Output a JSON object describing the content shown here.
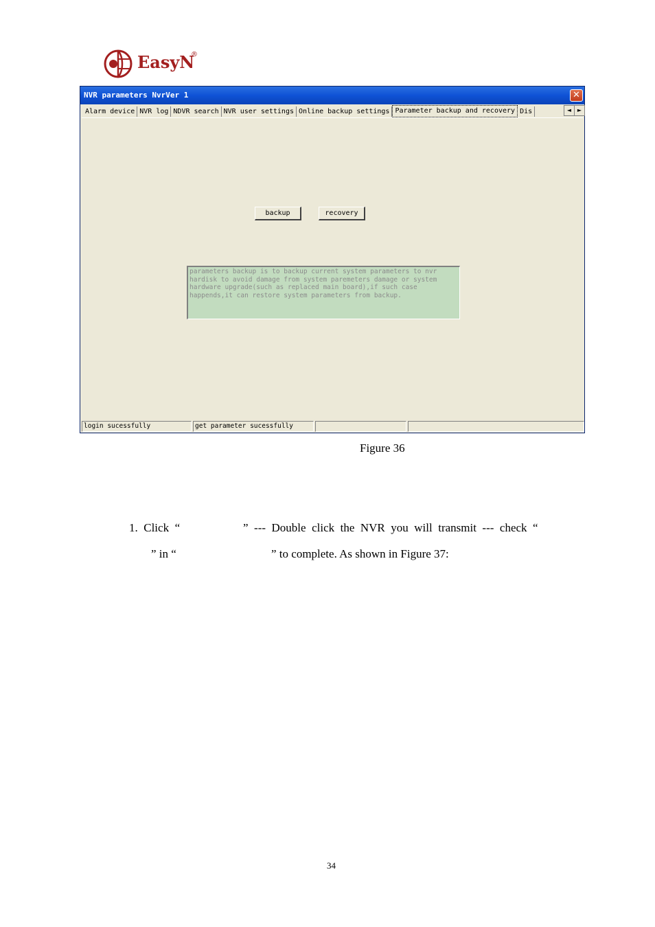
{
  "logo": {
    "text": "EasyN",
    "registered": "®",
    "color": "#a31f1f"
  },
  "window": {
    "title": "NVR parameters NvrVer 1",
    "close": "✕",
    "tabs": [
      "Alarm device",
      "NVR log",
      "NDVR search",
      "NVR user settings",
      "Online backup settings",
      "Parameter backup and recovery",
      "Dis"
    ],
    "active_tab": "Parameter backup and recovery",
    "tab_scroll_left": "◄",
    "tab_scroll_right": "►",
    "backup_label": "backup",
    "recovery_label": "recovery",
    "info_text": "parameters backup is to backup current system parameters to nvr hardisk to avoid damage from system paremeters damage or system hardware upgrade(such as replaced main board),if such case happends,it can restore system parameters from backup.",
    "status": [
      "login sucessfully",
      "get parameter sucessfully",
      "",
      ""
    ]
  },
  "caption": "Figure 36",
  "paragraph": {
    "line1_a": "1.  Click  “",
    "line1_b": "”  ---  Double  click  the  NVR  you  will  transmit  ---  check  “",
    "line2_a": "” in “",
    "line2_b": "” to complete. As shown in Figure 37:"
  },
  "page_number": "34"
}
